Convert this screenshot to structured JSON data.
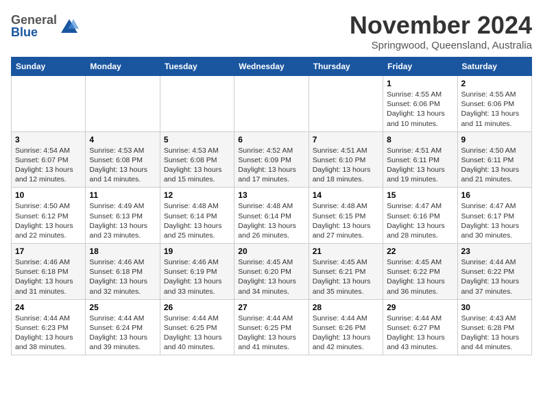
{
  "header": {
    "logo": {
      "general": "General",
      "blue": "Blue"
    },
    "title": "November 2024",
    "location": "Springwood, Queensland, Australia"
  },
  "calendar": {
    "days_of_week": [
      "Sunday",
      "Monday",
      "Tuesday",
      "Wednesday",
      "Thursday",
      "Friday",
      "Saturday"
    ],
    "weeks": [
      [
        {
          "day": "",
          "info": ""
        },
        {
          "day": "",
          "info": ""
        },
        {
          "day": "",
          "info": ""
        },
        {
          "day": "",
          "info": ""
        },
        {
          "day": "",
          "info": ""
        },
        {
          "day": "1",
          "info": "Sunrise: 4:55 AM\nSunset: 6:06 PM\nDaylight: 13 hours\nand 10 minutes."
        },
        {
          "day": "2",
          "info": "Sunrise: 4:55 AM\nSunset: 6:06 PM\nDaylight: 13 hours\nand 11 minutes."
        }
      ],
      [
        {
          "day": "3",
          "info": "Sunrise: 4:54 AM\nSunset: 6:07 PM\nDaylight: 13 hours\nand 12 minutes."
        },
        {
          "day": "4",
          "info": "Sunrise: 4:53 AM\nSunset: 6:08 PM\nDaylight: 13 hours\nand 14 minutes."
        },
        {
          "day": "5",
          "info": "Sunrise: 4:53 AM\nSunset: 6:08 PM\nDaylight: 13 hours\nand 15 minutes."
        },
        {
          "day": "6",
          "info": "Sunrise: 4:52 AM\nSunset: 6:09 PM\nDaylight: 13 hours\nand 17 minutes."
        },
        {
          "day": "7",
          "info": "Sunrise: 4:51 AM\nSunset: 6:10 PM\nDaylight: 13 hours\nand 18 minutes."
        },
        {
          "day": "8",
          "info": "Sunrise: 4:51 AM\nSunset: 6:11 PM\nDaylight: 13 hours\nand 19 minutes."
        },
        {
          "day": "9",
          "info": "Sunrise: 4:50 AM\nSunset: 6:11 PM\nDaylight: 13 hours\nand 21 minutes."
        }
      ],
      [
        {
          "day": "10",
          "info": "Sunrise: 4:50 AM\nSunset: 6:12 PM\nDaylight: 13 hours\nand 22 minutes."
        },
        {
          "day": "11",
          "info": "Sunrise: 4:49 AM\nSunset: 6:13 PM\nDaylight: 13 hours\nand 23 minutes."
        },
        {
          "day": "12",
          "info": "Sunrise: 4:48 AM\nSunset: 6:14 PM\nDaylight: 13 hours\nand 25 minutes."
        },
        {
          "day": "13",
          "info": "Sunrise: 4:48 AM\nSunset: 6:14 PM\nDaylight: 13 hours\nand 26 minutes."
        },
        {
          "day": "14",
          "info": "Sunrise: 4:48 AM\nSunset: 6:15 PM\nDaylight: 13 hours\nand 27 minutes."
        },
        {
          "day": "15",
          "info": "Sunrise: 4:47 AM\nSunset: 6:16 PM\nDaylight: 13 hours\nand 28 minutes."
        },
        {
          "day": "16",
          "info": "Sunrise: 4:47 AM\nSunset: 6:17 PM\nDaylight: 13 hours\nand 30 minutes."
        }
      ],
      [
        {
          "day": "17",
          "info": "Sunrise: 4:46 AM\nSunset: 6:18 PM\nDaylight: 13 hours\nand 31 minutes."
        },
        {
          "day": "18",
          "info": "Sunrise: 4:46 AM\nSunset: 6:18 PM\nDaylight: 13 hours\nand 32 minutes."
        },
        {
          "day": "19",
          "info": "Sunrise: 4:46 AM\nSunset: 6:19 PM\nDaylight: 13 hours\nand 33 minutes."
        },
        {
          "day": "20",
          "info": "Sunrise: 4:45 AM\nSunset: 6:20 PM\nDaylight: 13 hours\nand 34 minutes."
        },
        {
          "day": "21",
          "info": "Sunrise: 4:45 AM\nSunset: 6:21 PM\nDaylight: 13 hours\nand 35 minutes."
        },
        {
          "day": "22",
          "info": "Sunrise: 4:45 AM\nSunset: 6:22 PM\nDaylight: 13 hours\nand 36 minutes."
        },
        {
          "day": "23",
          "info": "Sunrise: 4:44 AM\nSunset: 6:22 PM\nDaylight: 13 hours\nand 37 minutes."
        }
      ],
      [
        {
          "day": "24",
          "info": "Sunrise: 4:44 AM\nSunset: 6:23 PM\nDaylight: 13 hours\nand 38 minutes."
        },
        {
          "day": "25",
          "info": "Sunrise: 4:44 AM\nSunset: 6:24 PM\nDaylight: 13 hours\nand 39 minutes."
        },
        {
          "day": "26",
          "info": "Sunrise: 4:44 AM\nSunset: 6:25 PM\nDaylight: 13 hours\nand 40 minutes."
        },
        {
          "day": "27",
          "info": "Sunrise: 4:44 AM\nSunset: 6:25 PM\nDaylight: 13 hours\nand 41 minutes."
        },
        {
          "day": "28",
          "info": "Sunrise: 4:44 AM\nSunset: 6:26 PM\nDaylight: 13 hours\nand 42 minutes."
        },
        {
          "day": "29",
          "info": "Sunrise: 4:44 AM\nSunset: 6:27 PM\nDaylight: 13 hours\nand 43 minutes."
        },
        {
          "day": "30",
          "info": "Sunrise: 4:43 AM\nSunset: 6:28 PM\nDaylight: 13 hours\nand 44 minutes."
        }
      ]
    ]
  }
}
